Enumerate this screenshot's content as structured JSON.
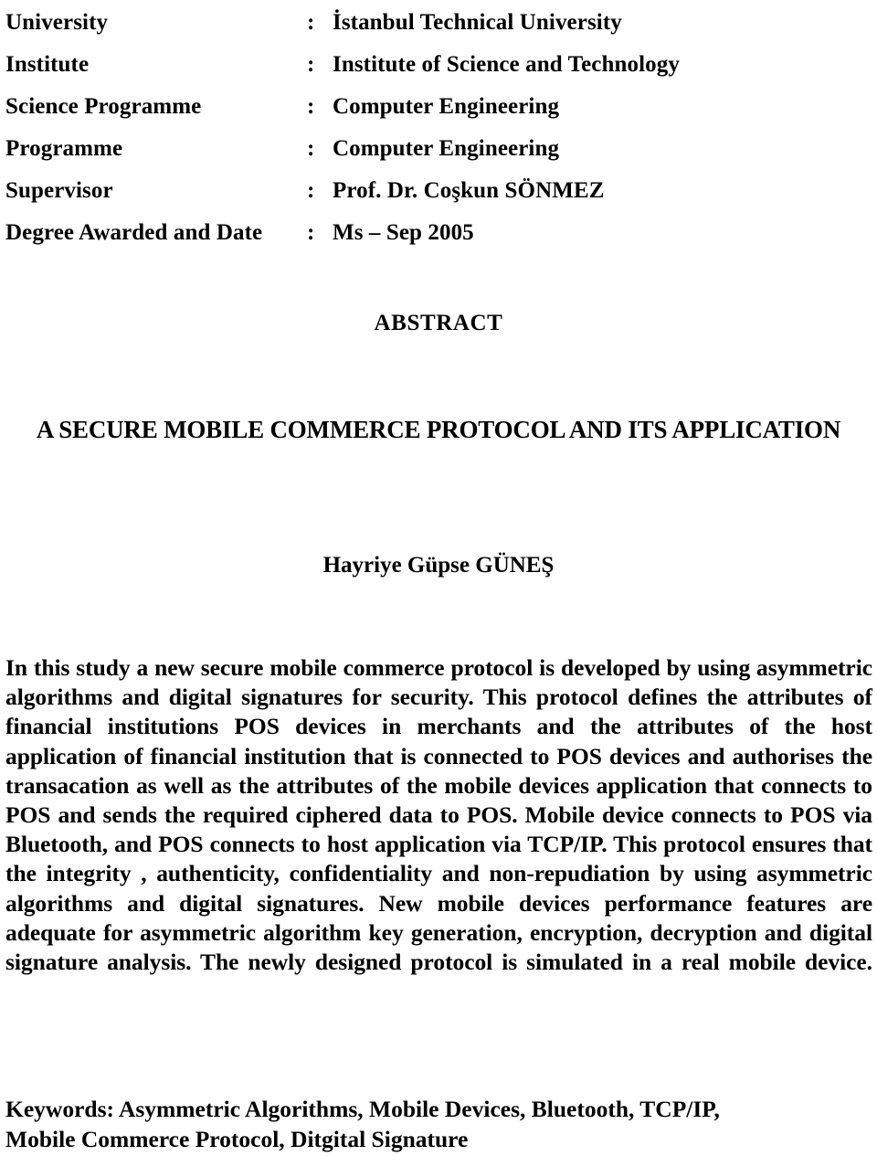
{
  "document": {
    "metadata_rows": [
      {
        "label": "University",
        "separator": ":",
        "value": "İstanbul Technical University"
      },
      {
        "label": "Institute",
        "separator": ":",
        "value": "Institute of Science and Technology"
      },
      {
        "label": "Science Programme",
        "separator": ":",
        "value": "Computer Engineering"
      },
      {
        "label": "Programme",
        "separator": ":",
        "value": "Computer Engineering"
      },
      {
        "label": "Supervisor",
        "separator": ":",
        "value": "Prof. Dr. Coşkun SÖNMEZ"
      },
      {
        "label": "Degree Awarded and Date",
        "separator": ":",
        "value": "Ms – Sep 2005"
      }
    ],
    "abstract_heading": "ABSTRACT",
    "thesis_title": "A SECURE MOBILE COMMERCE PROTOCOL AND ITS APPLICATION",
    "author": "Hayriye Güpse GÜNEŞ",
    "abstract_body": "In this study a new secure mobile commerce protocol is developed by using asymmetric algorithms and digital signatures for security. This protocol defines the attributes of financial institutions POS devices in merchants and the attributes of the host application of financial institution that is connected to POS devices and authorises the transacation as well as the attributes of the mobile devices application that connects to POS and sends the required ciphered data to POS. Mobile device connects to POS via Bluetooth, and POS connects to host application via TCP/IP. This protocol ensures that the integrity , authenticity, confidentiality and non-repudiation by using asymmetric algorithms and digital signatures. New mobile devices performance features are adequate for asymmetric algorithm key generation, encryption, decryption and digital signature analysis. The newly designed protocol is simulated in a real mobile device.",
    "keywords_line_1": "Keywords: Asymmetric Algorithms, Mobile Devices, Bluetooth, TCP/IP,",
    "keywords_line_2": "Mobile Commerce Protocol, Ditgital Signature",
    "colors": {
      "text": "#000000",
      "background": "#ffffff"
    }
  }
}
